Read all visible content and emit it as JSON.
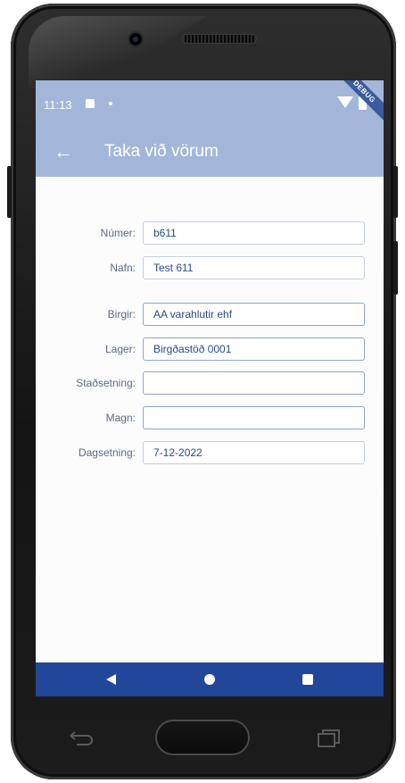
{
  "status_bar": {
    "time": "11:13",
    "debug_label": "DEBUG"
  },
  "app_bar": {
    "title": "Taka við vörum"
  },
  "form": {
    "fields": [
      {
        "label": "Númer:",
        "value": "b611"
      },
      {
        "label": "Nafn:",
        "value": "Test 611"
      },
      {
        "label": "Birgir:",
        "value": "AA varahlutir ehf"
      },
      {
        "label": "Lager:",
        "value": "Birgðastöð 0001"
      },
      {
        "label": "Staðsetning:",
        "value": ""
      },
      {
        "label": "Magn:",
        "value": ""
      },
      {
        "label": "Dagsetning:",
        "value": "7-12-2022"
      }
    ]
  },
  "icons": {
    "back": "arrow-left-icon",
    "nav_back": "triangle-back-icon",
    "nav_home": "circle-home-icon",
    "nav_recents": "square-recents-icon"
  },
  "colors": {
    "app_bar": "#a3b6da",
    "nav_bar": "#21469a",
    "field_text": "#2a4a8a",
    "label_text": "#5d6b86"
  }
}
